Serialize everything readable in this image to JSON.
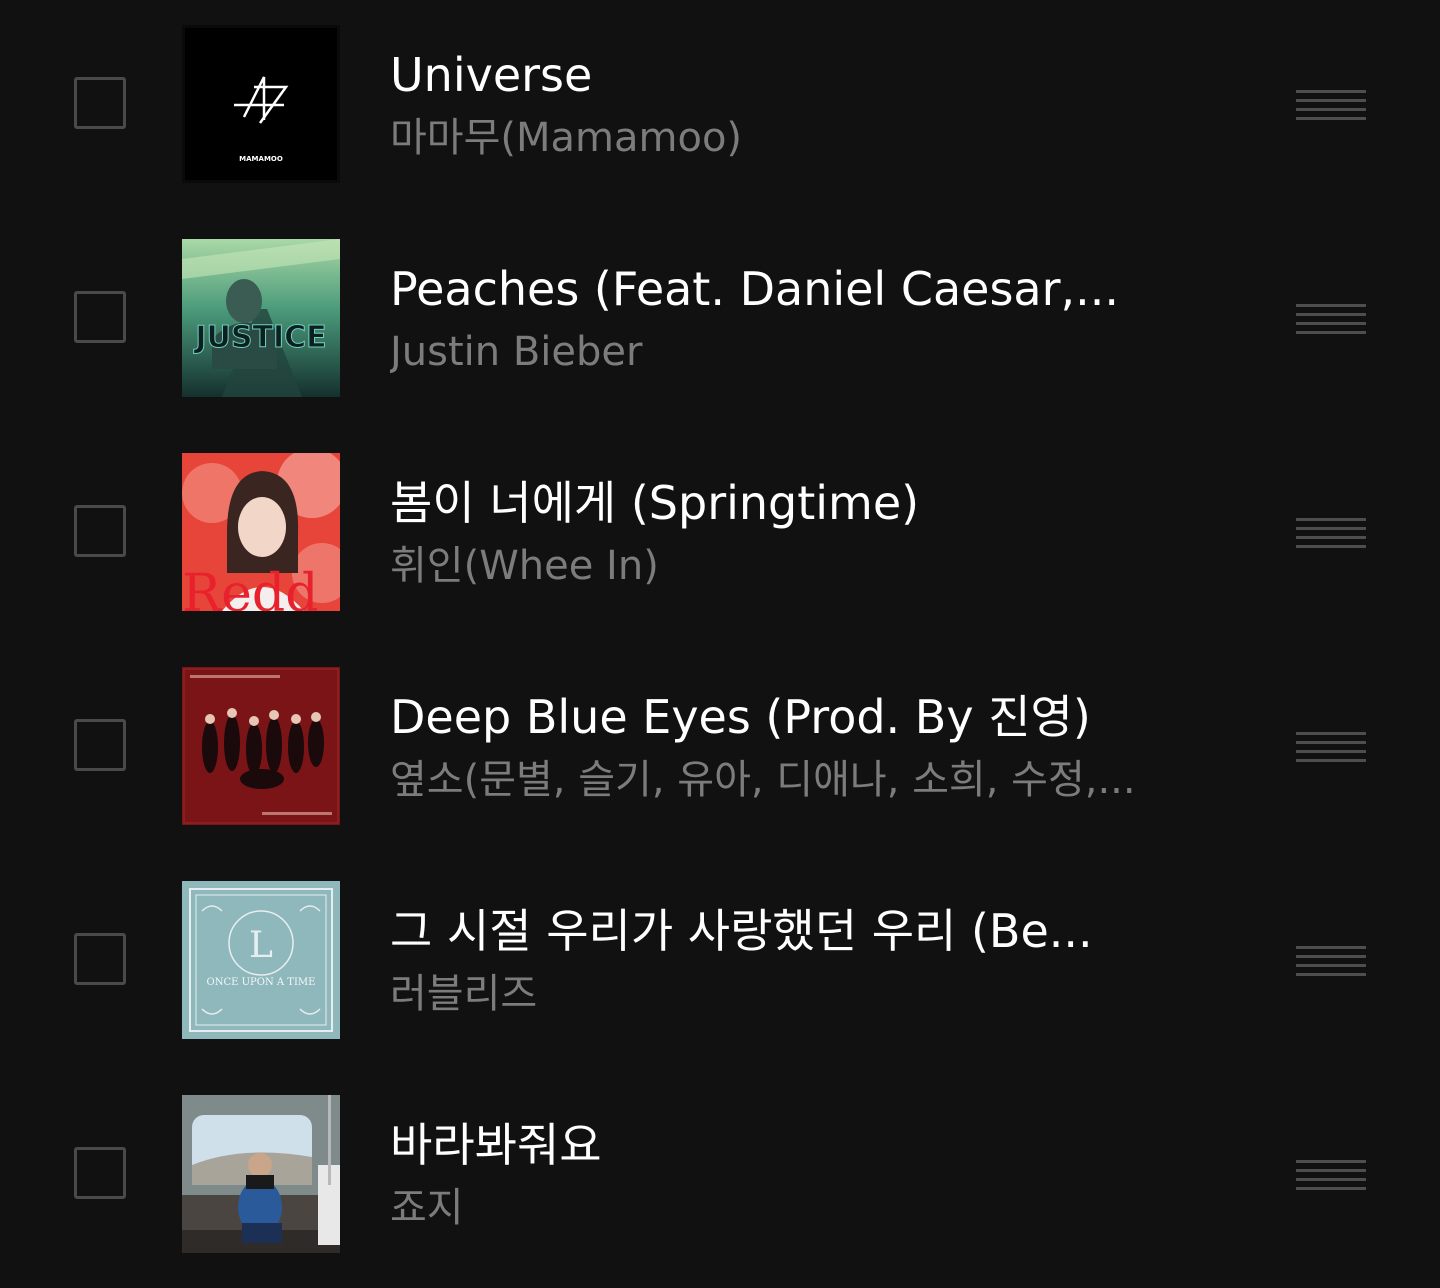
{
  "songs": [
    {
      "title": "Universe",
      "artist": "마마무(Mamamoo)",
      "art_icon": "mamamoo-album-art",
      "art_text": "MAMAMOO"
    },
    {
      "title": "Peaches (Feat. Daniel Caesar,...",
      "artist": "Justin Bieber",
      "art_icon": "justice-album-art",
      "art_text": "JUSTICE"
    },
    {
      "title": "봄이 너에게 (Springtime)",
      "artist": "휘인(Whee In)",
      "art_icon": "redd-album-art",
      "art_text": "Redd"
    },
    {
      "title": "Deep Blue Eyes (Prod. By 진영)",
      "artist": "옆소(문별, 슬기, 유아, 디애나, 소희, 수정,...",
      "art_icon": "deep-blue-eyes-album-art"
    },
    {
      "title": "그 시절 우리가 사랑했던 우리 (Be...",
      "artist": "러블리즈",
      "art_icon": "once-upon-a-time-album-art",
      "art_text": "ONCE UPON A TIME"
    },
    {
      "title": "바라봐줘요",
      "artist": "죠지",
      "art_icon": "subway-album-art"
    }
  ],
  "colors": {
    "background": "#111111",
    "title": "#ffffff",
    "artist": "#7c7c7c",
    "checkbox_border": "#4a4a4a",
    "handle": "#4e4e4e"
  }
}
